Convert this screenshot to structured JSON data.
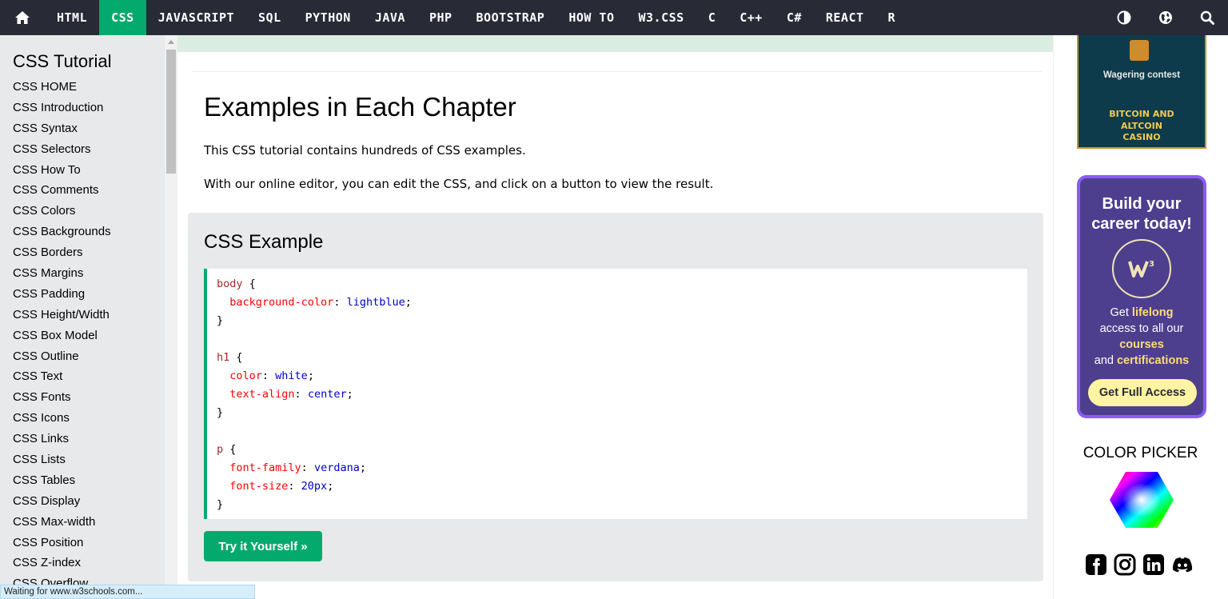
{
  "topnav": {
    "items": [
      "HTML",
      "CSS",
      "JAVASCRIPT",
      "SQL",
      "PYTHON",
      "JAVA",
      "PHP",
      "BOOTSTRAP",
      "HOW TO",
      "W3.CSS",
      "C",
      "C++",
      "C#",
      "REACT",
      "R"
    ],
    "active": "CSS",
    "icons": [
      "home-icon",
      "theme-toggle-icon",
      "globe-icon",
      "search-icon"
    ],
    "accent_color": "#04aa6d",
    "bg_color": "#282a35"
  },
  "sidebar": {
    "title": "CSS Tutorial",
    "items": [
      "CSS HOME",
      "CSS Introduction",
      "CSS Syntax",
      "CSS Selectors",
      "CSS How To",
      "CSS Comments",
      "CSS Colors",
      "CSS Backgrounds",
      "CSS Borders",
      "CSS Margins",
      "CSS Padding",
      "CSS Height/Width",
      "CSS Box Model",
      "CSS Outline",
      "CSS Text",
      "CSS Fonts",
      "CSS Icons",
      "CSS Links",
      "CSS Lists",
      "CSS Tables",
      "CSS Display",
      "CSS Max-width",
      "CSS Position",
      "CSS Z-index",
      "CSS Overflow"
    ]
  },
  "main": {
    "title": "Examples in Each Chapter",
    "para1": "This CSS tutorial contains hundreds of CSS examples.",
    "para2": "With our online editor, you can edit the CSS, and click on a button to view the result.",
    "example": {
      "heading": "CSS Example",
      "code_lines": [
        [
          {
            "t": "body",
            "c": "sel"
          },
          {
            "t": " {",
            "c": "br"
          }
        ],
        [
          {
            "t": "  background-color",
            "c": "prop"
          },
          {
            "t": ": ",
            "c": "br"
          },
          {
            "t": "lightblue",
            "c": "val"
          },
          {
            "t": ";",
            "c": "br"
          }
        ],
        [
          {
            "t": "}",
            "c": "br"
          }
        ],
        [],
        [
          {
            "t": "h1",
            "c": "sel"
          },
          {
            "t": " {",
            "c": "br"
          }
        ],
        [
          {
            "t": "  color",
            "c": "prop"
          },
          {
            "t": ": ",
            "c": "br"
          },
          {
            "t": "white",
            "c": "val"
          },
          {
            "t": ";",
            "c": "br"
          }
        ],
        [
          {
            "t": "  text-align",
            "c": "prop"
          },
          {
            "t": ": ",
            "c": "br"
          },
          {
            "t": "center",
            "c": "val"
          },
          {
            "t": ";",
            "c": "br"
          }
        ],
        [
          {
            "t": "}",
            "c": "br"
          }
        ],
        [],
        [
          {
            "t": "p",
            "c": "sel"
          },
          {
            "t": " {",
            "c": "br"
          }
        ],
        [
          {
            "t": "  font-family",
            "c": "prop"
          },
          {
            "t": ": ",
            "c": "br"
          },
          {
            "t": "verdana",
            "c": "val"
          },
          {
            "t": ";",
            "c": "br"
          }
        ],
        [
          {
            "t": "  font-size",
            "c": "prop"
          },
          {
            "t": ": ",
            "c": "br"
          },
          {
            "t": "20px",
            "c": "val"
          },
          {
            "t": ";",
            "c": "br"
          }
        ],
        [
          {
            "t": "}",
            "c": "br"
          }
        ]
      ],
      "button": "Try it Yourself »"
    }
  },
  "right": {
    "ad_top": {
      "line1": "Wagering contest",
      "line2": "BITCOIN AND",
      "line3": "ALTCOIN",
      "line4": "CASINO"
    },
    "career": {
      "title1": "Build your",
      "title2": "career today!",
      "text_get": "Get ",
      "text_lifelong": "lifelong",
      "text_access": "access to all our",
      "text_courses": "courses",
      "text_and": "and ",
      "text_certifications": "certifications",
      "button": "Get Full Access"
    },
    "color_picker": "COLOR PICKER",
    "social_icons": [
      "facebook-icon",
      "instagram-icon",
      "linkedin-icon",
      "discord-icon"
    ]
  },
  "status_bar": "Waiting for www.w3schools.com..."
}
